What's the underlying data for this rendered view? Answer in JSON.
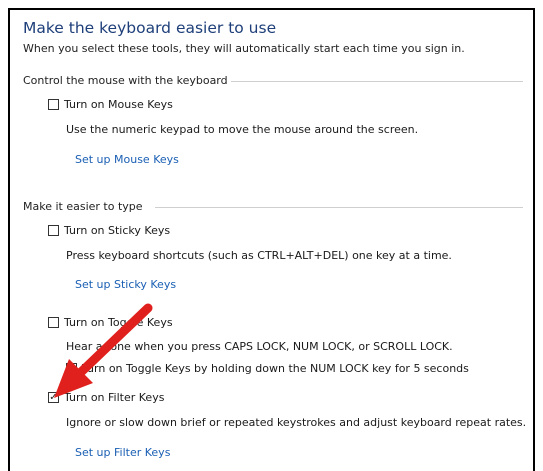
{
  "header": {
    "title": "Make the keyboard easier to use",
    "subtitle": "When you select these tools, they will automatically start each time you sign in."
  },
  "mouse_group": {
    "label": "Control the mouse with the keyboard",
    "mouse_keys": {
      "label": "Turn on Mouse Keys",
      "checked": false,
      "description": "Use the numeric keypad to move the mouse around the screen.",
      "setup_link": "Set up Mouse Keys"
    }
  },
  "typing_group": {
    "label": "Make it easier to type",
    "sticky_keys": {
      "label": "Turn on Sticky Keys",
      "checked": false,
      "description": "Press keyboard shortcuts (such as CTRL+ALT+DEL) one key at a time.",
      "setup_link": "Set up Sticky Keys"
    },
    "toggle_keys": {
      "label": "Turn on Toggle Keys",
      "checked": false,
      "description": "Hear a tone when you press CAPS LOCK, NUM LOCK, or SCROLL LOCK.",
      "sub_option_label": "Turn on Toggle Keys by holding down the NUM LOCK key for 5 seconds",
      "sub_option_checked": true
    },
    "filter_keys": {
      "label": "Turn on Filter Keys",
      "checked": true,
      "description": "Ignore or slow down brief or repeated keystrokes and adjust keyboard repeat rates.",
      "setup_link": "Set up Filter Keys"
    }
  },
  "colors": {
    "title": "#1e3f7a",
    "link": "#1a5fb4",
    "annotation_arrow": "#e0201c"
  }
}
